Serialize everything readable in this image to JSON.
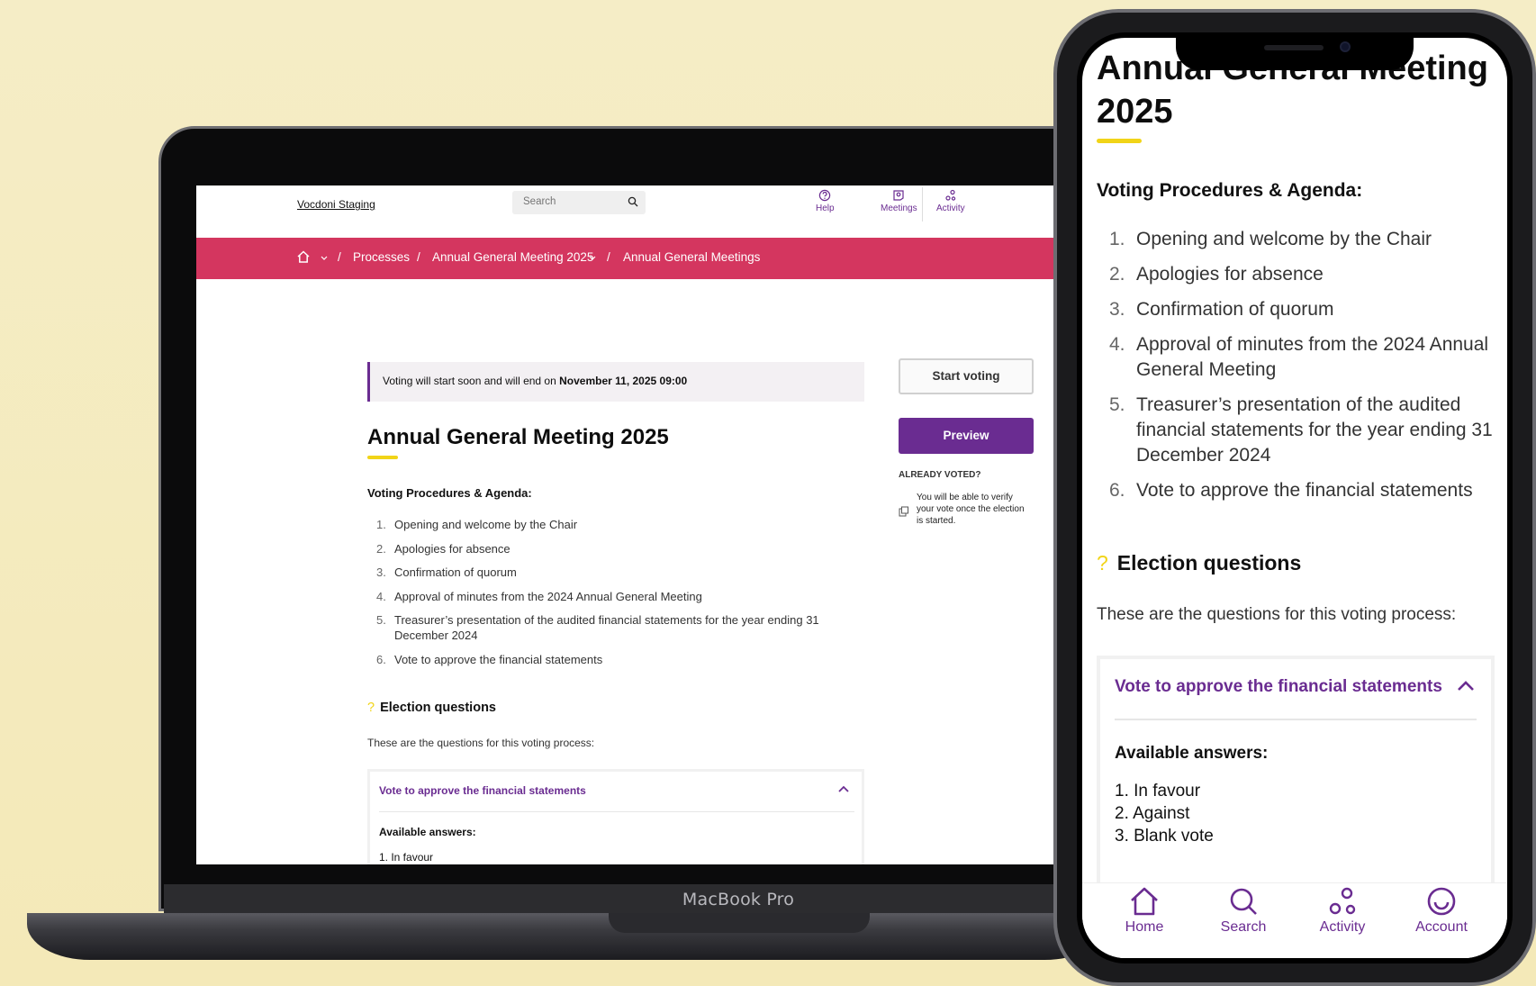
{
  "desktop": {
    "org_name": "Vocdoni Staging",
    "search_placeholder": "Search",
    "nav": {
      "help": "Help",
      "meetings": "Meetings",
      "activity": "Activity"
    },
    "breadcrumb": {
      "sep": "/",
      "processes": "Processes",
      "meeting": "Annual General Meeting 2025",
      "meetings": "Annual General Meetings"
    },
    "banner_prefix": "Voting will start soon and will end on ",
    "banner_date": "November 11, 2025 09:00",
    "title": "Annual General Meeting 2025",
    "agenda_heading": "Voting Procedures & Agenda:",
    "agenda": [
      {
        "num": "1.",
        "text": "Opening and welcome by the Chair"
      },
      {
        "num": "2.",
        "text": "Apologies for absence"
      },
      {
        "num": "3.",
        "text": "Confirmation of quorum"
      },
      {
        "num": "4.",
        "text": "Approval of minutes from the 2024 Annual General Meeting"
      },
      {
        "num": "5.",
        "text": "Treasurer’s presentation of the audited financial statements for the year ending 31 December 2024"
      },
      {
        "num": "6.",
        "text": "Vote to approve the financial statements"
      }
    ],
    "election_heading": "Election questions",
    "election_sub": "These are the questions for this voting process:",
    "question": "Vote to approve the financial statements",
    "available_answers": "Available answers:",
    "first_answer": "1. In favour",
    "start_voting": "Start voting",
    "preview": "Preview",
    "already_voted": "ALREADY VOTED?",
    "verify_text": "You will be able to verify your vote once the election is started."
  },
  "laptop_label": "MacBook Pro",
  "mobile": {
    "title": "Annual General Meeting 2025",
    "agenda_heading": "Voting Procedures & Agenda:",
    "agenda": [
      {
        "num": "1.",
        "text": "Opening and welcome by the Chair"
      },
      {
        "num": "2.",
        "text": "Apologies for absence"
      },
      {
        "num": "3.",
        "text": "Confirmation of quorum"
      },
      {
        "num": "4.",
        "text": "Approval of minutes from the 2024 Annual General Meeting"
      },
      {
        "num": "5.",
        "text": "Treasurer’s presentation of the audited financial statements for the year ending 31 December 2024"
      },
      {
        "num": "6.",
        "text": "Vote to approve the financial statements"
      }
    ],
    "election_heading": "Election questions",
    "election_sub": "These are the questions for this voting process:",
    "question": "Vote to approve the financial statements",
    "available_answers": "Available answers:",
    "answers": [
      "1. In favour",
      "2. Against",
      "3. Blank vote"
    ],
    "tabs": {
      "home": "Home",
      "search": "Search",
      "activity": "Activity",
      "account": "Account"
    }
  },
  "colors": {
    "accent_purple": "#6a2c91",
    "breadcrumb_red": "#d4365f",
    "highlight_yellow": "#f1d418",
    "background": "#f5edc6"
  }
}
